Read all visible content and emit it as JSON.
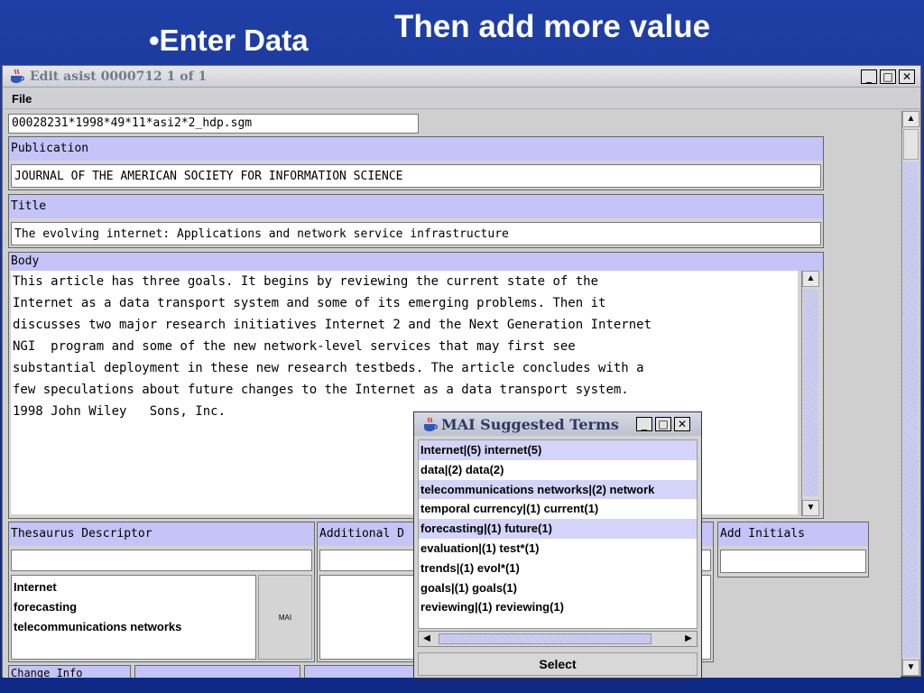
{
  "slide": {
    "bullet": "•Enter Data",
    "heading": "Then add more value"
  },
  "window": {
    "title": "Edit asist 0000712  1 of 1",
    "controls": {
      "minimize": "_",
      "maximize": "□",
      "close": "✕"
    },
    "menu": {
      "file": "File"
    }
  },
  "record": {
    "id_value": "00028231*1998*49*11*asi2*2_hdp.sgm",
    "publication_label": "Publication",
    "publication_value": "JOURNAL OF THE AMERICAN SOCIETY FOR INFORMATION SCIENCE",
    "title_label": "Title",
    "title_value": "The evolving internet: Applications and network service infrastructure",
    "body_label": "Body",
    "body_value": "This article has three goals. It begins by reviewing the current state of the\nInternet as a data transport system and some of its emerging problems. Then it\ndiscusses two major research initiatives Internet 2 and the Next Generation Internet\nNGI  program and some of the new network-level services that may first see\nsubstantial deployment in these new research testbeds. The article concludes with a\nfew speculations about future changes to the Internet as a data transport system.\n1998 John Wiley   Sons, Inc."
  },
  "thesaurus": {
    "label": "Thesaurus Descriptor",
    "input_value": "",
    "items": [
      "Internet",
      "forecasting",
      "telecommunications networks"
    ],
    "mai_button": "MAI"
  },
  "additional": {
    "label": "Additional D",
    "input_value": ""
  },
  "initials": {
    "label": "Add Initials",
    "input_value": ""
  },
  "change_info": {
    "label": "Change Info"
  },
  "popup": {
    "title": "MAI Suggested Terms",
    "controls": {
      "minimize": "_",
      "maximize": "□",
      "close": "✕"
    },
    "terms": [
      "Internet|(5) internet(5)",
      "data|(2) data(2)",
      "telecommunications networks|(2) network",
      "temporal currency|(1) current(1)",
      "forecasting|(1) future(1)",
      "evaluation|(1) test*(1)",
      "trends|(1) evol*(1)",
      "goals|(1) goals(1)",
      "reviewing|(1) reviewing(1)"
    ],
    "highlighted": [
      0,
      2,
      4
    ],
    "select_label": "Select"
  },
  "icons": {
    "app": "java-coffee-cup-icon",
    "scroll_up": "arrow-up-icon",
    "scroll_down": "arrow-down-icon",
    "scroll_left": "arrow-left-icon",
    "scroll_right": "arrow-right-icon"
  },
  "colors": {
    "slide_bg": "#1f3fa6",
    "label_bg": "#c4c4f8",
    "highlight_bg": "#d4d4fb"
  }
}
